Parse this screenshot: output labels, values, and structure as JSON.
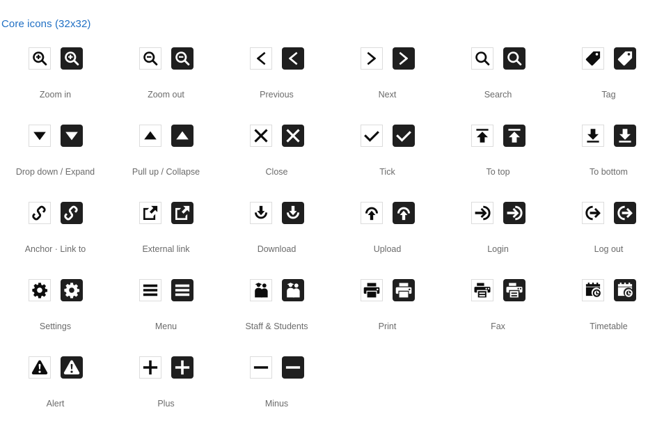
{
  "page": {
    "title": "Core icons (32x32)",
    "title_color": "#1f6fc4",
    "label_color": "#6b6b6b",
    "dark_swatch_color": "#1f1f1f",
    "light_box_border_color": "#dcdcdc",
    "background_color": "#ffffff",
    "icon_size_label": "32x32"
  },
  "icons": [
    {
      "id": "zoom-in",
      "label": "Zoom in",
      "glyph": "zoom-in-icon"
    },
    {
      "id": "zoom-out",
      "label": "Zoom out",
      "glyph": "zoom-out-icon"
    },
    {
      "id": "previous",
      "label": "Previous",
      "glyph": "chevron-left-icon"
    },
    {
      "id": "next",
      "label": "Next",
      "glyph": "chevron-right-icon"
    },
    {
      "id": "search",
      "label": "Search",
      "glyph": "search-icon"
    },
    {
      "id": "tag",
      "label": "Tag",
      "glyph": "tag-icon"
    },
    {
      "id": "drop-down-expand",
      "label": "Drop down / Expand",
      "glyph": "triangle-down-icon"
    },
    {
      "id": "pull-up-collapse",
      "label": "Pull up / Collapse",
      "glyph": "triangle-up-icon"
    },
    {
      "id": "close",
      "label": "Close",
      "glyph": "close-icon"
    },
    {
      "id": "tick",
      "label": "Tick",
      "glyph": "tick-icon"
    },
    {
      "id": "to-top",
      "label": "To top",
      "glyph": "to-top-icon"
    },
    {
      "id": "to-bottom",
      "label": "To bottom",
      "glyph": "to-bottom-icon"
    },
    {
      "id": "anchor-link-to",
      "label": "Anchor · Link to",
      "glyph": "chain-link-icon"
    },
    {
      "id": "external-link",
      "label": "External link",
      "glyph": "external-link-icon"
    },
    {
      "id": "download",
      "label": "Download",
      "glyph": "download-icon"
    },
    {
      "id": "upload",
      "label": "Upload",
      "glyph": "upload-icon"
    },
    {
      "id": "login",
      "label": "Login",
      "glyph": "login-icon"
    },
    {
      "id": "log-out",
      "label": "Log out",
      "glyph": "logout-icon"
    },
    {
      "id": "settings",
      "label": "Settings",
      "glyph": "gear-icon"
    },
    {
      "id": "menu",
      "label": "Menu",
      "glyph": "menu-icon"
    },
    {
      "id": "staff-students",
      "label": "Staff & Students",
      "glyph": "people-icon"
    },
    {
      "id": "print",
      "label": "Print",
      "glyph": "printer-icon"
    },
    {
      "id": "fax",
      "label": "Fax",
      "glyph": "fax-icon"
    },
    {
      "id": "timetable",
      "label": "Timetable",
      "glyph": "calendar-clock-icon"
    },
    {
      "id": "alert",
      "label": "Alert",
      "glyph": "alert-triangle-icon"
    },
    {
      "id": "plus",
      "label": "Plus",
      "glyph": "plus-icon"
    },
    {
      "id": "minus",
      "label": "Minus",
      "glyph": "minus-icon"
    }
  ]
}
